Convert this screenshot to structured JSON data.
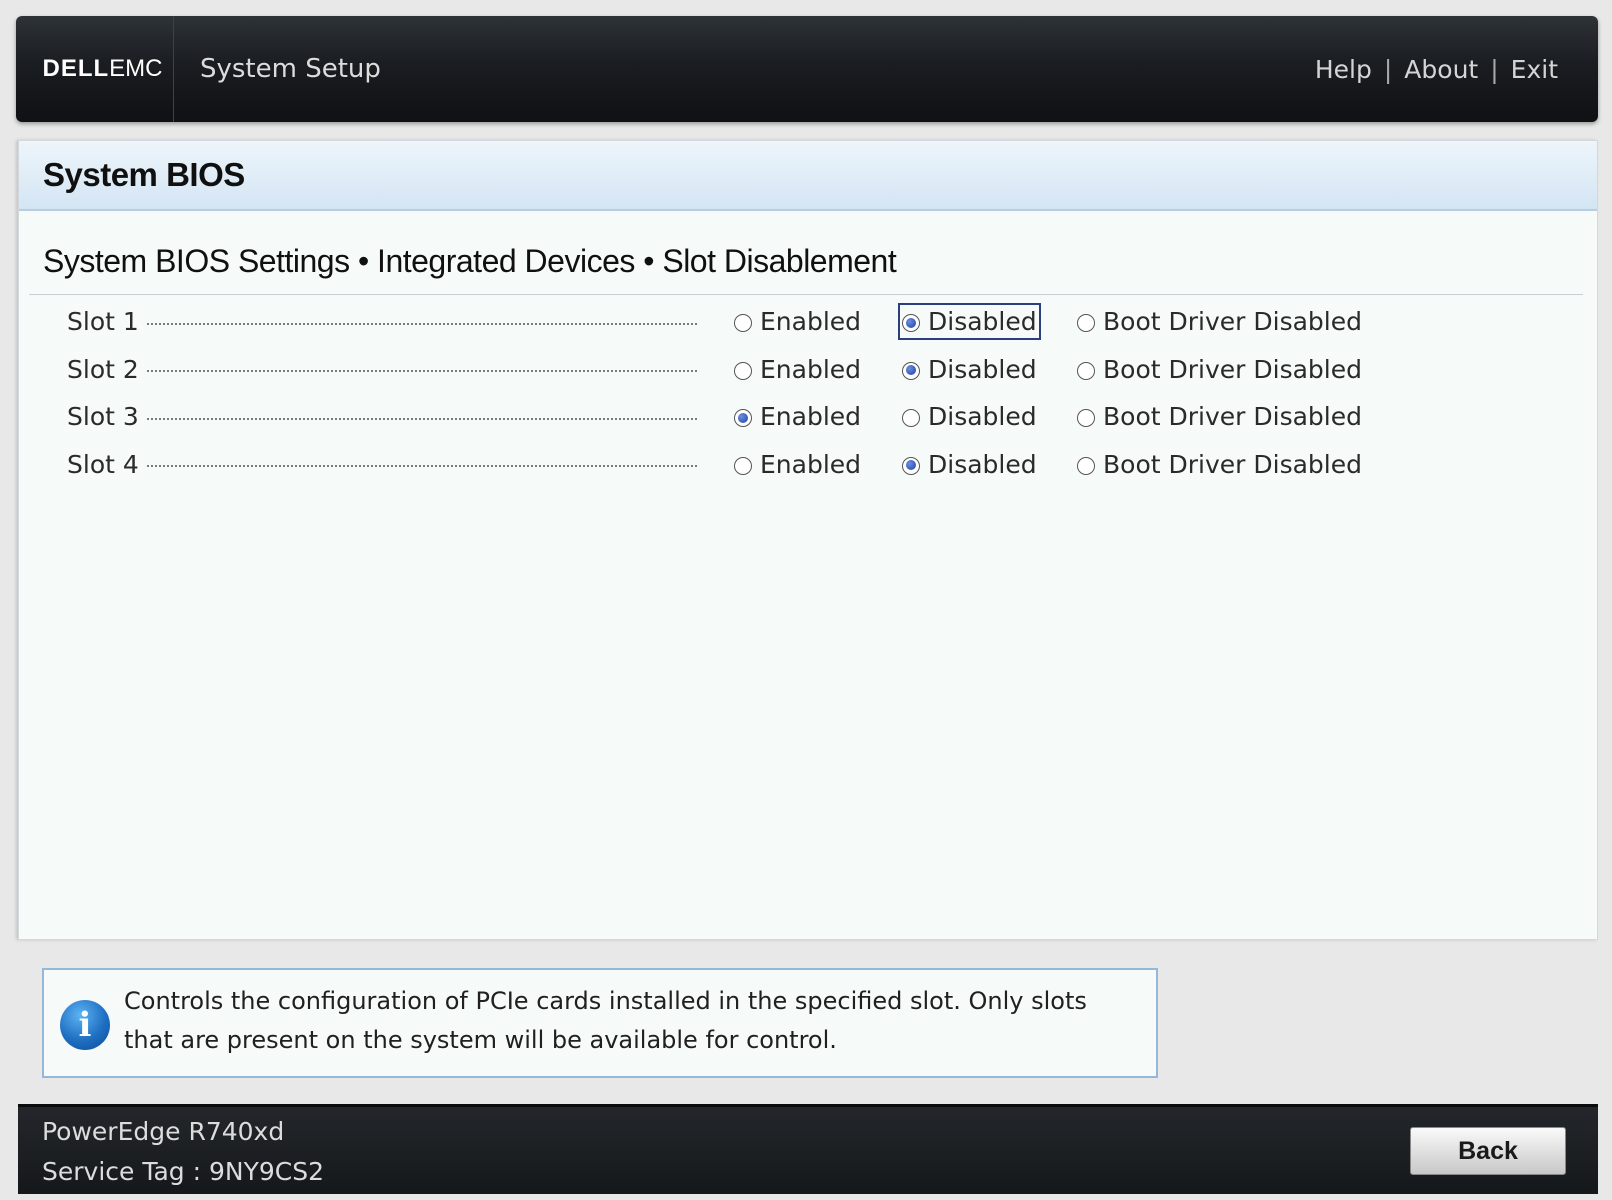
{
  "header": {
    "logo_dell": "DELL",
    "logo_emc": "EMC",
    "title": "System Setup",
    "links": [
      "Help",
      "About",
      "Exit"
    ],
    "separator": "|"
  },
  "panel": {
    "title": "System BIOS",
    "breadcrumb": "System BIOS Settings • Integrated Devices • Slot Disablement"
  },
  "options": [
    "Enabled",
    "Disabled",
    "Boot Driver Disabled"
  ],
  "slots": [
    {
      "label": "Slot 1",
      "selected": "Disabled"
    },
    {
      "label": "Slot 2",
      "selected": "Disabled"
    },
    {
      "label": "Slot 3",
      "selected": "Enabled"
    },
    {
      "label": "Slot 4",
      "selected": "Disabled"
    }
  ],
  "focused": {
    "slot": "Slot 1",
    "option": "Disabled"
  },
  "help": {
    "icon": "info-icon",
    "icon_glyph": "i",
    "text": "Controls the configuration of PCIe cards installed in the specified slot. Only slots that are present on the system will be available for control."
  },
  "footer": {
    "model": "PowerEdge R740xd",
    "service_tag": "Service Tag : 9NY9CS2",
    "back_label": "Back"
  }
}
